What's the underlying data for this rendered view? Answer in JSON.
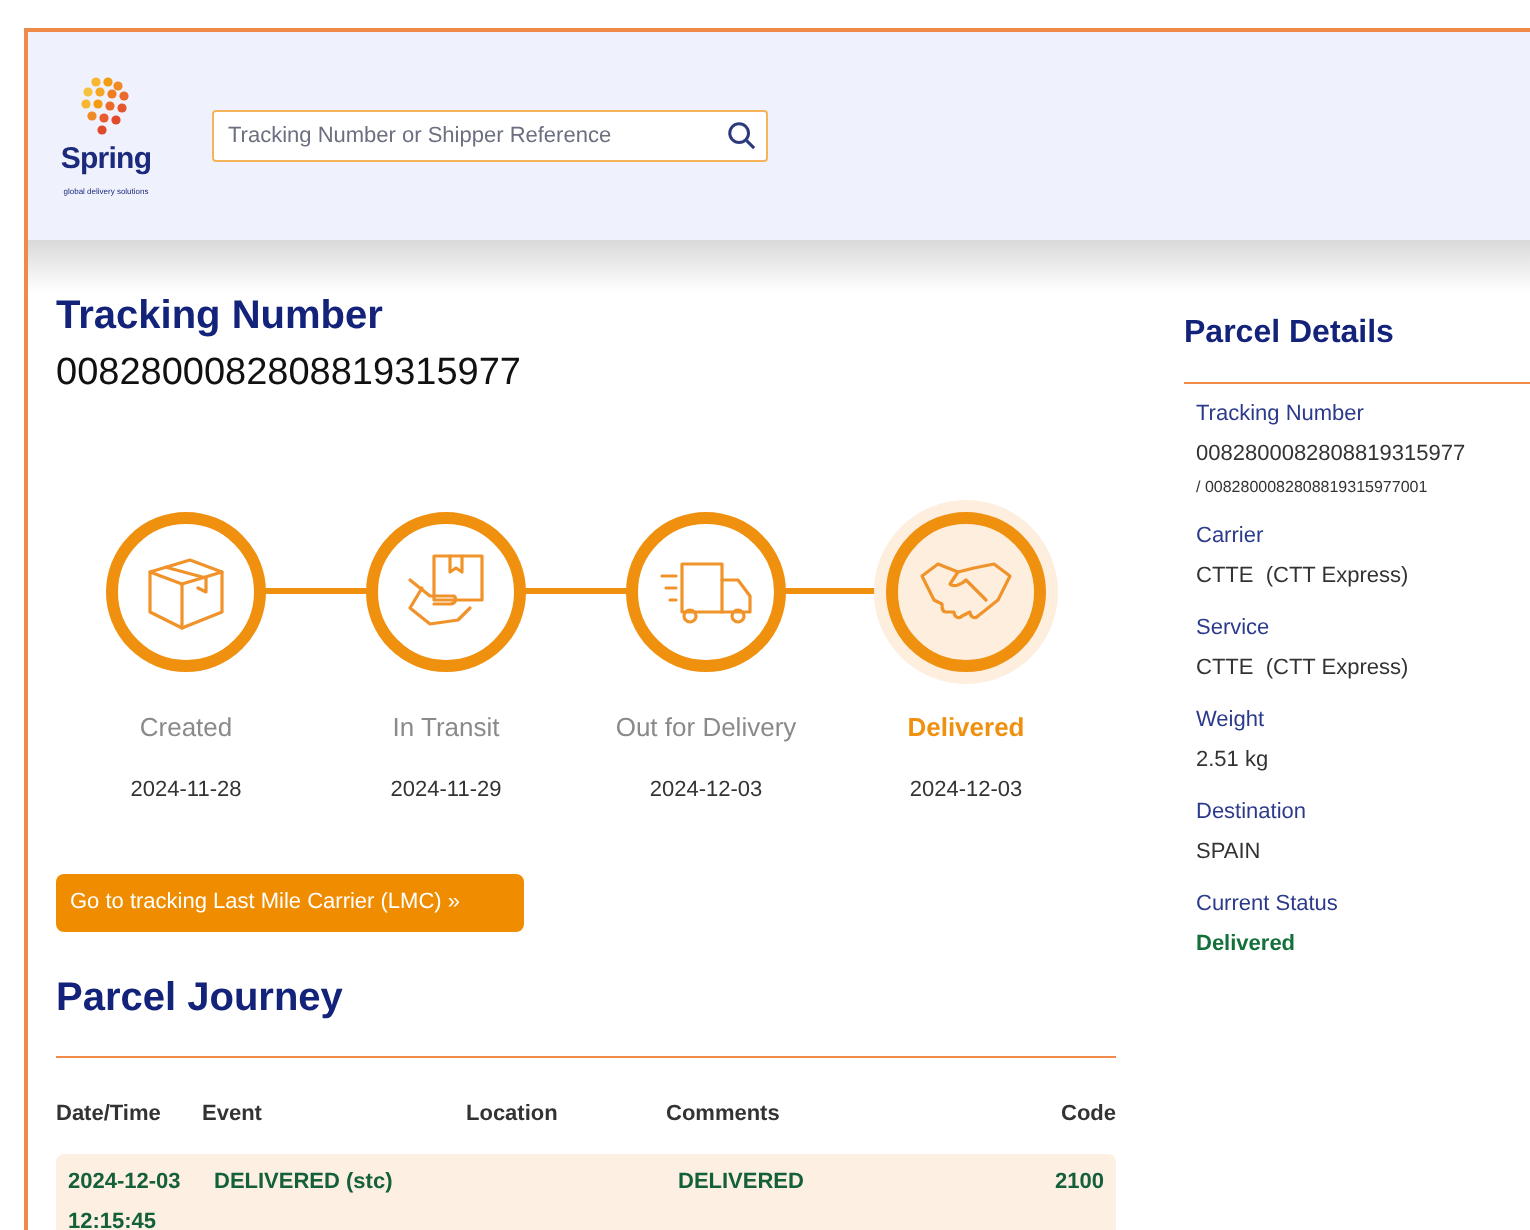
{
  "header": {
    "logo": {
      "name": "Spring",
      "tagline": "global delivery solutions"
    },
    "search": {
      "placeholder": "Tracking Number or Shipper Reference"
    }
  },
  "tracking": {
    "title": "Tracking Number",
    "number": "0082800082808819315977"
  },
  "steps": [
    {
      "kind": "box",
      "label": "Created",
      "date": "2024-11-28",
      "selected": false
    },
    {
      "kind": "handover",
      "label": "In Transit",
      "date": "2024-11-29",
      "selected": false
    },
    {
      "kind": "truck",
      "label": "Out for Delivery",
      "date": "2024-12-03",
      "selected": false
    },
    {
      "kind": "handshake",
      "label": "Delivered",
      "date": "2024-12-03",
      "selected": true
    }
  ],
  "lmc_button": "Go to tracking Last Mile Carrier (LMC) »",
  "journey": {
    "title": "Parcel Journey",
    "columns": [
      "Date/Time",
      "Event",
      "Location",
      "Comments",
      "Code"
    ],
    "rows": [
      {
        "date": "2024-12-03",
        "time": "12:15:45",
        "event": "DELIVERED (stc)",
        "comments": "DELIVERED",
        "code": "2100"
      }
    ]
  },
  "details": {
    "title": "Parcel Details",
    "fields": [
      {
        "label": "Tracking Number",
        "value": "0082800082808819315977",
        "sub": "/ 0082800082808819315977001"
      },
      {
        "label": "Carrier",
        "value": "CTTE  (CTT Express)"
      },
      {
        "label": "Service",
        "value": "CTTE  (CTT Express)"
      },
      {
        "label": "Weight",
        "value": "2.51 kg"
      },
      {
        "label": "Destination",
        "value": "SPAIN"
      },
      {
        "label": "Current Status",
        "value": "Delivered",
        "kind": "status"
      }
    ]
  }
}
